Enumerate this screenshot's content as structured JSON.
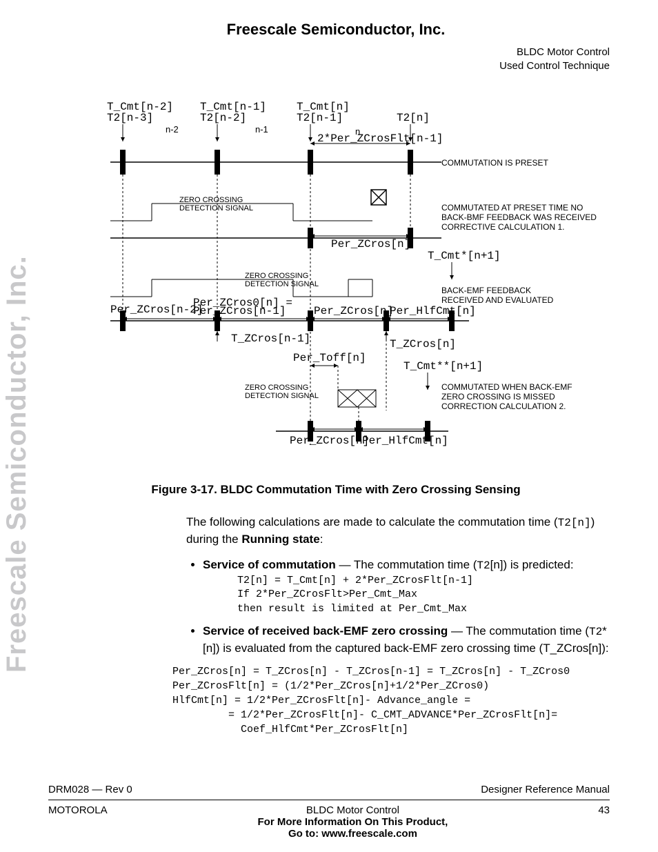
{
  "header": {
    "company": "Freescale Semiconductor, Inc.",
    "section_line1": "BLDC Motor Control",
    "section_line2": "Used Control Technique"
  },
  "watermark": "Freescale Semiconductor, Inc.",
  "figure": {
    "caption": "Figure 3-17. BLDC Commutation Time with Zero Crossing Sensing",
    "labels": {
      "tcmt_n2": "T_Cmt[n-2]",
      "tcmt_n1": "T_Cmt[n-1]",
      "tcmt_n": "T_Cmt[n]",
      "t2_n3": "T2[n-3]",
      "t2_n2": "T2[n-2]",
      "t2_n1": "T2[n-1]",
      "t2_n": "T2[n]",
      "idx_n2": "n-2",
      "idx_n1": "n-1",
      "idx_n": "n",
      "two_per": "2*Per_ZCrosFlt[n-1]",
      "comm_preset": "COMMUTATION IS PRESET",
      "zc_signal": "ZERO CROSSING\nDETECTION SIGNAL",
      "comm_preset_time": "COMMUTATED AT PRESET TIME NO\nBACK-BMF FEEDBACK WAS RECEIVED\nCORRECTIVE CALCULATION 1.",
      "per_zcros_n": "Per_ZCros[n]",
      "tcmt_star_n1": "T_Cmt*[n+1]",
      "back_emf_eval": "BACK-EMF FEEDBACK\nRECEIVED AND EVALUATED",
      "per_zcros_n2": "Per_ZCros[n-2]",
      "per_zcros0_eq": "Per_ZCros0[n] =\nPer_ZCros[n-1]",
      "per_hlfcmt_n": "Per_HlfCmt[n]",
      "t_zcros_n1": "T_ZCros[n-1]",
      "t_zcros_n": "T_ZCros[n]",
      "per_toff_n": "Per_Toff[n]",
      "tcmt_starstar": "T_Cmt**[n+1]",
      "comm_missed": "COMMUTATED WHEN BACK-EMF\nZERO CROSSING IS MISSED\nCORRECTION CALCULATION 2."
    }
  },
  "body": {
    "intro_pre": "The following calculations are made to calculate the commutation time (",
    "intro_code": "T2[n]",
    "intro_mid": ") during the ",
    "intro_bold": "Running state",
    "intro_post": ":",
    "bullet1_bold": "Service of commutation",
    "bullet1_mid": " — The commutation time  (",
    "bullet1_code": "T2",
    "bullet1_post": "[n]) is predicted:",
    "code1": "T2[n] = T_Cmt[n] + 2*Per_ZCrosFlt[n-1]\nIf 2*Per_ZCrosFlt>Per_Cmt_Max\nthen result is limited at Per_Cmt_Max",
    "bullet2_bold": "Service of received back-EMF zero crossing",
    "bullet2_mid": " — The commutation time  (",
    "bullet2_code": "T2",
    "bullet2_post": "*[n]) is evaluated from the captured back-EMF zero crossing time (T_ZCros[n]):",
    "code2": "Per_ZCros[n] = T_ZCros[n] - T_ZCros[n-1] = T_ZCros[n] - T_ZCros0\nPer_ZCrosFlt[n] = (1/2*Per_ZCros[n]+1/2*Per_ZCros0)\nHlfCmt[n] = 1/2*Per_ZCrosFlt[n]- Advance_angle =\n         = 1/2*Per_ZCrosFlt[n]- C_CMT_ADVANCE*Per_ZCrosFlt[n]=\n           Coef_HlfCmt*Per_ZCrosFlt[n]"
  },
  "footer": {
    "doc_id": "DRM028 — Rev 0",
    "manual": "Designer Reference Manual",
    "brand": "MOTOROLA",
    "title": "BLDC Motor Control",
    "page": "43",
    "info1": "For More Information On This Product,",
    "info2": "Go to: www.freescale.com"
  }
}
